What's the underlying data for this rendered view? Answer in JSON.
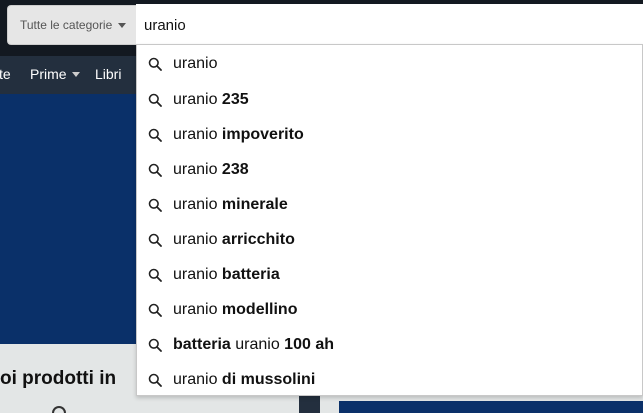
{
  "search": {
    "category_label": "Tutte le categorie",
    "query": "uranio"
  },
  "nav": {
    "partial_item": "te",
    "prime_label": "Prime",
    "books_label": "Libri"
  },
  "page": {
    "section_title_partial": "oi prodotti in"
  },
  "suggestions": [
    {
      "prefix": "uranio",
      "bold": "",
      "suffix": ""
    },
    {
      "prefix": "uranio ",
      "bold": "235",
      "suffix": ""
    },
    {
      "prefix": "uranio ",
      "bold": "impoverito",
      "suffix": ""
    },
    {
      "prefix": "uranio ",
      "bold": "238",
      "suffix": ""
    },
    {
      "prefix": "uranio ",
      "bold": "minerale",
      "suffix": ""
    },
    {
      "prefix": "uranio ",
      "bold": "arricchito",
      "suffix": ""
    },
    {
      "prefix": "uranio ",
      "bold": "batteria",
      "suffix": ""
    },
    {
      "prefix": "uranio ",
      "bold": "modellino",
      "suffix": ""
    },
    {
      "prefix": "",
      "bold": "batteria",
      "suffix": " uranio ",
      "bold2": "100 ah"
    },
    {
      "prefix": "uranio ",
      "bold": "di mussolini",
      "suffix": ""
    }
  ]
}
